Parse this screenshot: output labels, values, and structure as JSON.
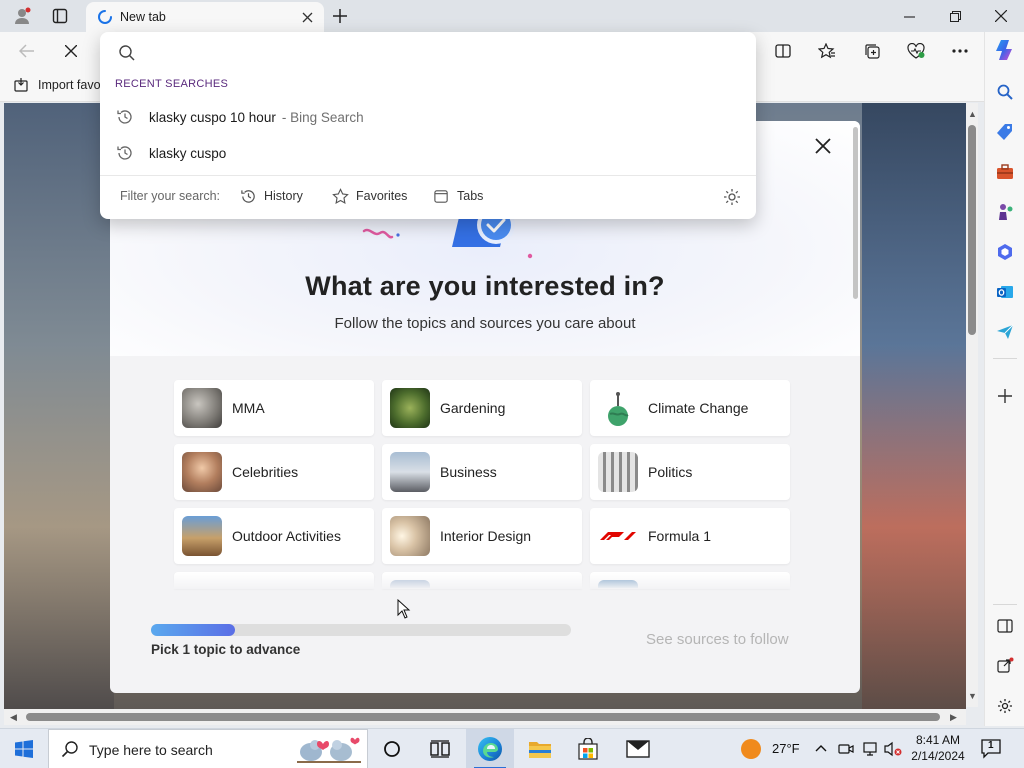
{
  "browser": {
    "tab_title": "New tab",
    "favorites_bar": {
      "import_label": "Import favo"
    }
  },
  "address_dropdown": {
    "section_title": "RECENT SEARCHES",
    "items": [
      {
        "query": "klasky cuspo 10 hour",
        "source": "- Bing Search"
      },
      {
        "query": "klasky cuspo",
        "source": ""
      }
    ],
    "filter_label": "Filter your search:",
    "filters": [
      {
        "label": "History",
        "icon": "history-icon"
      },
      {
        "label": "Favorites",
        "icon": "star-icon"
      },
      {
        "label": "Tabs",
        "icon": "tabs-icon"
      }
    ]
  },
  "modal": {
    "title": "What are you interested in?",
    "subtitle": "Follow the topics and sources you care about",
    "topics": [
      {
        "label": "MMA"
      },
      {
        "label": "Gardening"
      },
      {
        "label": "Climate Change"
      },
      {
        "label": "Celebrities"
      },
      {
        "label": "Business"
      },
      {
        "label": "Politics"
      },
      {
        "label": "Outdoor Activities"
      },
      {
        "label": "Interior Design"
      },
      {
        "label": "Formula 1"
      }
    ],
    "progress": {
      "fraction": 0.2,
      "label": "Pick 1 topic to advance"
    },
    "next_button": "See sources to follow"
  },
  "taskbar": {
    "search_placeholder": "Type here to search",
    "weather": "27°F",
    "time": "8:41 AM",
    "date": "2/14/2024",
    "notification_count": "1"
  },
  "colors": {
    "accent": "#2b6fd6",
    "progress_start": "#5aa8ee",
    "progress_end": "#5a6ee6",
    "section_title": "#5a2a7d"
  }
}
